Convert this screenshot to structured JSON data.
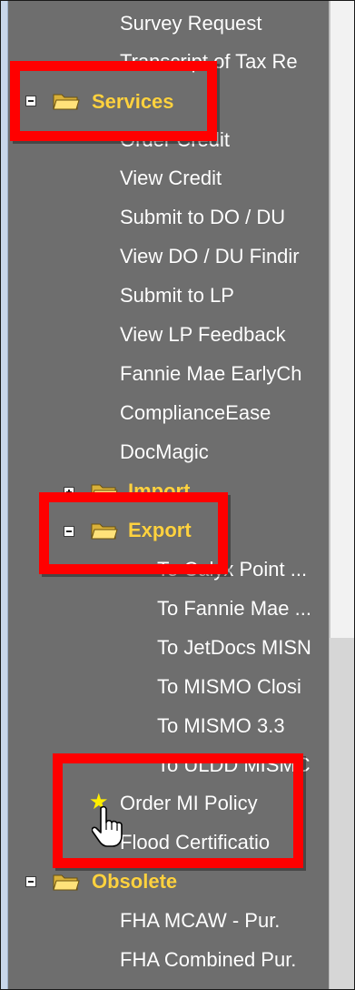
{
  "tree": {
    "items_top": [
      {
        "label": "Survey Request",
        "name": "tree-item-survey-request"
      },
      {
        "label": "Transcript of Tax Re",
        "name": "tree-item-transcript-of-tax-return"
      }
    ],
    "services": {
      "label": "Services",
      "toggle": "collapse",
      "children": [
        {
          "label": "Order Credit",
          "name": "tree-item-order-credit"
        },
        {
          "label": "View Credit",
          "name": "tree-item-view-credit"
        },
        {
          "label": "Submit to DO / DU",
          "name": "tree-item-submit-do-du"
        },
        {
          "label": "View DO / DU Findir",
          "name": "tree-item-view-do-du-findings"
        },
        {
          "label": "Submit to LP",
          "name": "tree-item-submit-lp"
        },
        {
          "label": "View LP Feedback",
          "name": "tree-item-view-lp-feedback"
        },
        {
          "label": "Fannie Mae EarlyCh",
          "name": "tree-item-fannie-mae-earlycheck"
        },
        {
          "label": "ComplianceEase",
          "name": "tree-item-complianceease"
        },
        {
          "label": "DocMagic",
          "name": "tree-item-docmagic"
        }
      ]
    },
    "import": {
      "label": "Import",
      "toggle": "expand"
    },
    "export": {
      "label": "Export",
      "toggle": "collapse",
      "children": [
        {
          "label": "To Calyx Point ...",
          "name": "tree-item-to-calyx-point"
        },
        {
          "label": "To Fannie Mae ...",
          "name": "tree-item-to-fannie-mae"
        },
        {
          "label": "To JetDocs MISN",
          "name": "tree-item-to-jetdocs-mismo"
        },
        {
          "label": "To MISMO Closi",
          "name": "tree-item-to-mismo-closing"
        },
        {
          "label": "To MISMO 3.3",
          "name": "tree-item-to-mismo-3-3"
        },
        {
          "label": "To ULDD MISMC",
          "name": "tree-item-to-uldd-mismo"
        }
      ]
    },
    "order_mi_policy": {
      "label": "Order MI Policy",
      "icon": "star-icon"
    },
    "flood_certification": {
      "label": "Flood Certificatio"
    },
    "obsolete": {
      "label": "Obsolete",
      "toggle": "collapse",
      "children": [
        {
          "label": "FHA MCAW - Pur.",
          "name": "tree-item-fha-mcaw-pur"
        },
        {
          "label": "FHA Combined Pur.",
          "name": "tree-item-fha-combined-pur"
        }
      ]
    }
  },
  "colors": {
    "panel_bg": "#6e6e6e",
    "item_text": "#ffffff",
    "folder_text": "#ffd23f",
    "highlight": "#ff0000",
    "star": "#ffee00"
  }
}
